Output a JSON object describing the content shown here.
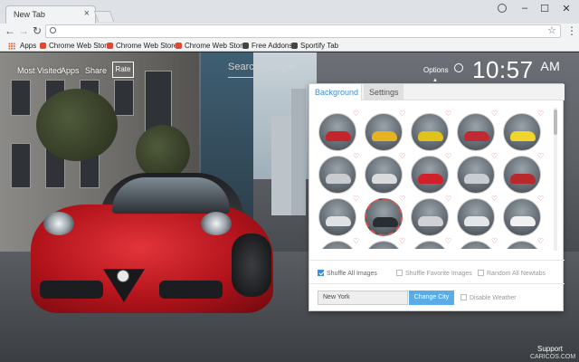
{
  "browser": {
    "tab_title": "New Tab",
    "tab_close": "×",
    "window_controls": [
      "–",
      "☐",
      "✕"
    ],
    "nav": {
      "back": "←",
      "forward": "→",
      "reload": "↻"
    },
    "omnibox_value": "",
    "star": "☆",
    "menu": "⋮",
    "bookmarks": [
      {
        "label": "Apps",
        "icon": "apps-grid-icon",
        "color": "#e35b2b"
      },
      {
        "label": "Chrome Web Store",
        "icon": "chrome-store-icon",
        "color": "#e2472f"
      },
      {
        "label": "Chrome Web Store",
        "icon": "chrome-store-icon",
        "color": "#e2472f"
      },
      {
        "label": "Chrome Web Store",
        "icon": "chrome-store-icon",
        "color": "#e2472f"
      },
      {
        "label": "Free Addons",
        "icon": "addon-icon",
        "color": "#444444"
      },
      {
        "label": "Sportify Tab",
        "icon": "addon-icon",
        "color": "#444444"
      }
    ]
  },
  "topnav": {
    "most_visited": "Most Visited",
    "apps": "Apps",
    "share": "Share",
    "rate": "Rate",
    "search_placeholder": "Search Google",
    "options": "Options",
    "clock": "10:57",
    "clock_suffix": "AM"
  },
  "footer": {
    "support": "Support",
    "credit": "CARICOS.COM"
  },
  "panel": {
    "tabs": [
      {
        "label": "Background",
        "active": true
      },
      {
        "label": "Settings",
        "active": false
      }
    ],
    "thumbnail_colors": [
      "#c4252d",
      "#e7b21f",
      "#e1c21b",
      "#c02a30",
      "#f0d52a",
      "#c8ccd0",
      "#d8dadc",
      "#d0202a",
      "#c9cdd1",
      "#b8282c",
      "#dfe2e5",
      "#2a2d31",
      "#cfd1d3",
      "#e4e6e8",
      "#f1f1f1",
      "#d12a2f",
      "#2b2e33",
      "#d9a020",
      "#a32026",
      "#c83a2a"
    ],
    "selected_index": 11,
    "options": [
      {
        "label": "Shuffle All Images",
        "checked": true
      },
      {
        "label": "Shuffle Favorite Images",
        "checked": false
      },
      {
        "label": "Random All Newtabs",
        "checked": false
      }
    ],
    "city_value": "New York",
    "change_city": "Change City",
    "disable_weather": "Disable Weather"
  }
}
